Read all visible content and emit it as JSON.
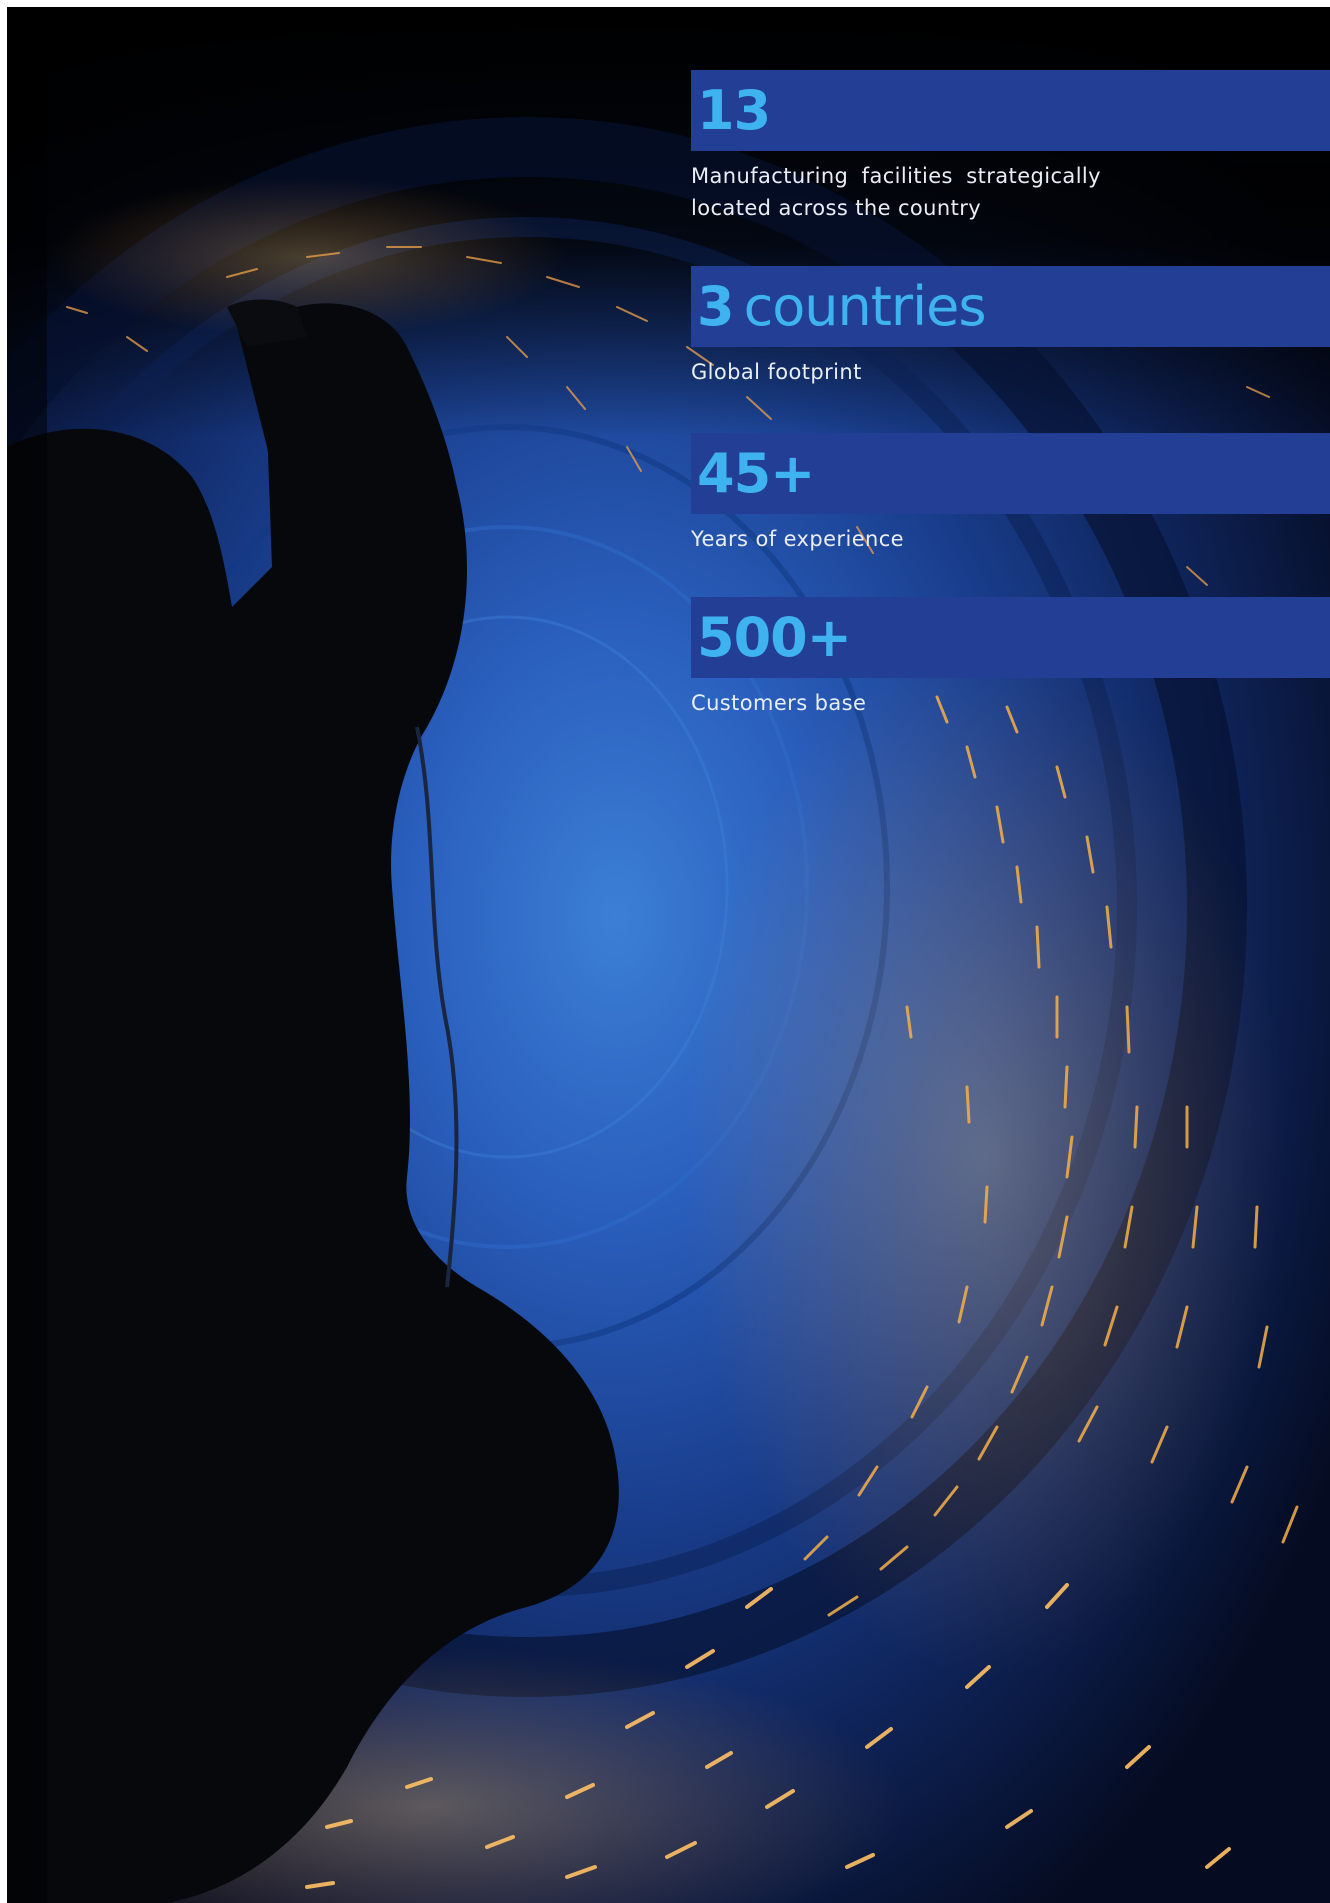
{
  "stats": [
    {
      "value": "13",
      "unit": "",
      "description": "Manufacturing facilities strategically located across the country"
    },
    {
      "value": "3",
      "unit": "countries",
      "description": "Global footprint"
    },
    {
      "value": "45+",
      "unit": "",
      "description": "Years of experience"
    },
    {
      "value": "500+",
      "unit": "",
      "description": "Customers base"
    }
  ],
  "colors": {
    "bar": "#233f95",
    "value_text": "#3eb3ef",
    "description_text": "#e9eef5",
    "tunnel_blue": "#1c4fa8",
    "spark_orange": "#f2a43a"
  },
  "image": {
    "subject": "welder-silhouette-in-steel-pipe-with-sparks-photo"
  }
}
